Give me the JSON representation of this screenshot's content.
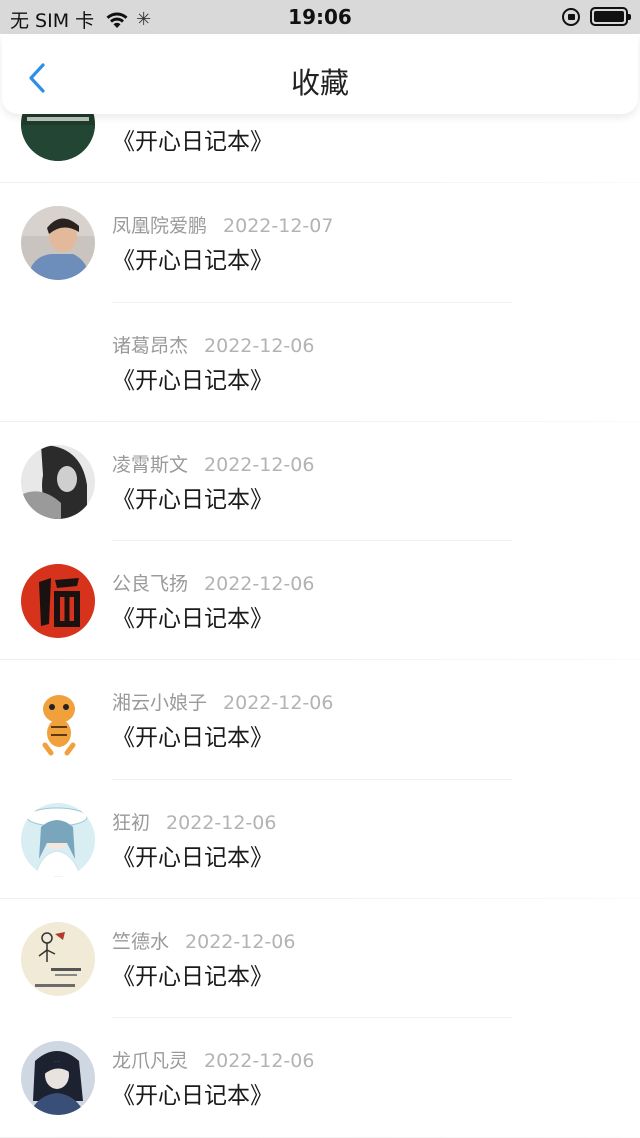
{
  "status_bar": {
    "carrier": "无 SIM 卡",
    "time": "19:06"
  },
  "nav": {
    "title": "收藏"
  },
  "book_title": "《开心日记本》",
  "items": [
    {
      "name": "",
      "date": "",
      "book": "《开心日记本》",
      "avatar": "dark-green-calligraphy"
    },
    {
      "name": "凤凰院爱鹏",
      "date": "2022-12-07",
      "book": "《开心日记本》",
      "avatar": "boy-photo"
    },
    {
      "name": "诸葛昂杰",
      "date": "2022-12-06",
      "book": "《开心日记本》",
      "avatar": "none"
    },
    {
      "name": "凌霄斯文",
      "date": "2022-12-06",
      "book": "《开心日记本》",
      "avatar": "girl-bw-photo"
    },
    {
      "name": "公良飞扬",
      "date": "2022-12-06",
      "book": "《开心日记本》",
      "avatar": "fu-character"
    },
    {
      "name": "湘云小娘子",
      "date": "2022-12-06",
      "book": "《开心日记本》",
      "avatar": "tiger-cartoon"
    },
    {
      "name": "狂初",
      "date": "2022-12-06",
      "book": "《开心日记本》",
      "avatar": "anime-girl"
    },
    {
      "name": "竺德水",
      "date": "2022-12-06",
      "book": "《开心日记本》",
      "avatar": "sketch-illustration"
    },
    {
      "name": "龙爪凡灵",
      "date": "2022-12-06",
      "book": "《开心日记本》",
      "avatar": "dark-anime"
    }
  ]
}
